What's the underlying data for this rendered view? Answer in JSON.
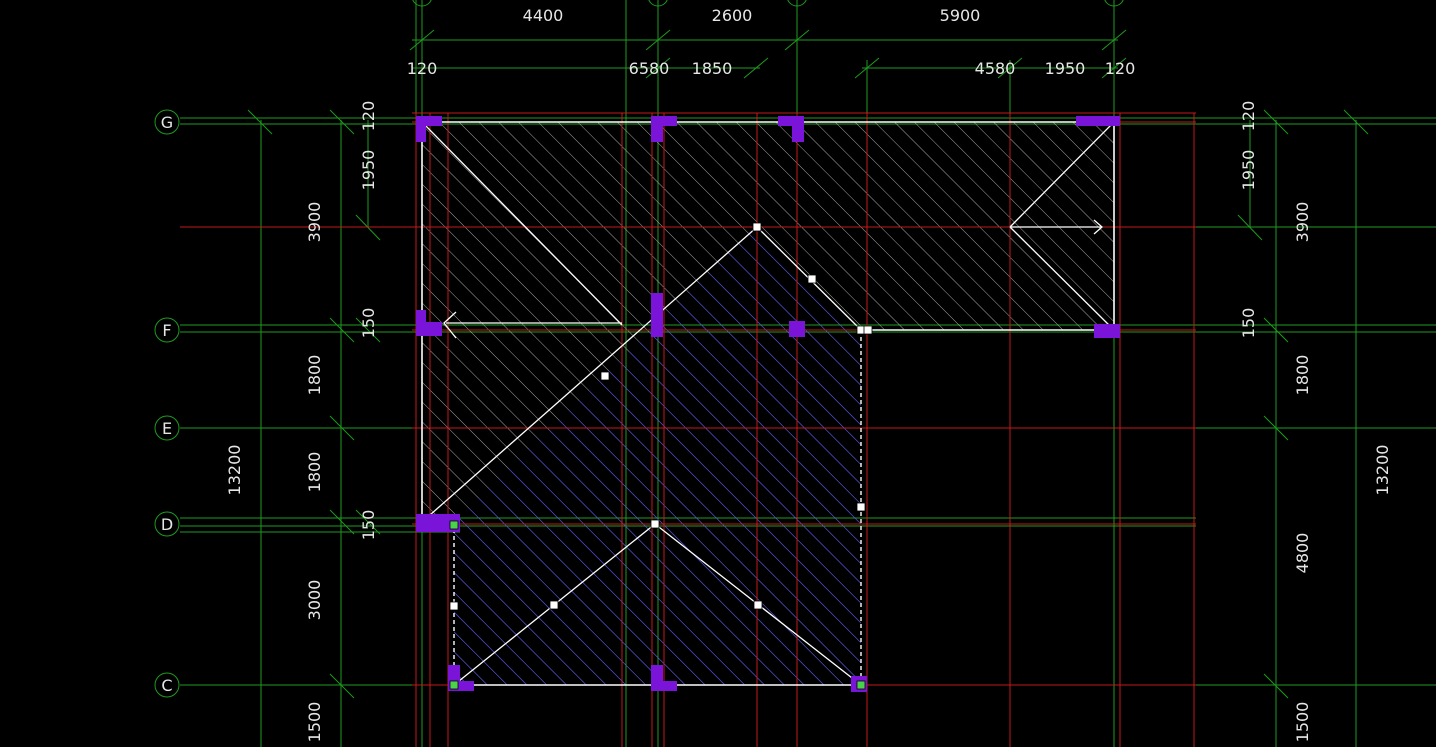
{
  "axes": {
    "horizontal": [
      "G",
      "F",
      "E",
      "D",
      "C"
    ]
  },
  "dimensions": {
    "top_row1": [
      "4400",
      "2600",
      "5900"
    ],
    "top_row2": [
      "120",
      "6580",
      "1850",
      "4580",
      "1950",
      "120"
    ],
    "left_outer": "13200",
    "left_mid": [
      "3900",
      "1800",
      "1800",
      "3000",
      "1500"
    ],
    "left_inner": [
      "120",
      "1950",
      "150",
      "150"
    ],
    "right_inner": [
      "120",
      "1950",
      "150"
    ],
    "right_mid": [
      "3900",
      "1800",
      "4800",
      "1500"
    ],
    "right_outer": "13200"
  },
  "colors": {
    "axis_grid": "#1f9a1f",
    "wall_lines": "#c41a1a",
    "roof_outline": "#ffffff",
    "selected_hatch": "#3a3aff",
    "columns": "#7a14d8"
  }
}
